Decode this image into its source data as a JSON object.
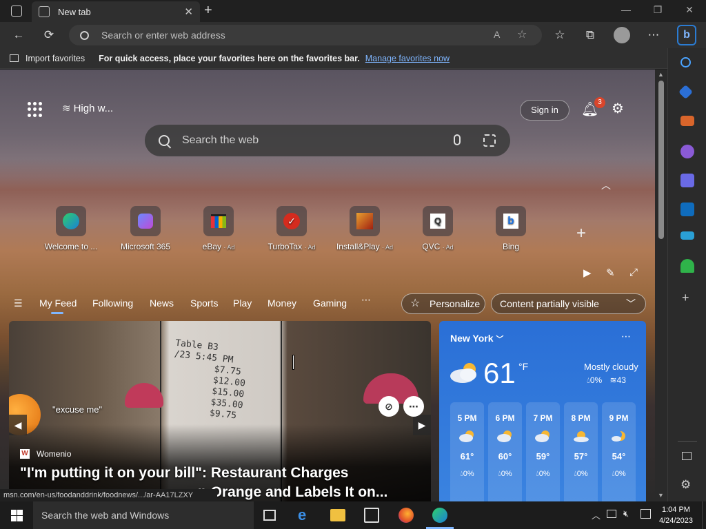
{
  "browser": {
    "tab_title": "New tab",
    "address_placeholder": "Search or enter web address",
    "favorites_bar": {
      "import_label": "Import favorites",
      "hint": "For quick access, place your favorites here on the favorites bar.",
      "manage_link": "Manage favorites now"
    }
  },
  "page": {
    "weather_mini": "High w...",
    "sign_in": "Sign in",
    "notification_count": "3",
    "search_placeholder": "Search the web",
    "quick_links": [
      {
        "label": "Welcome to ...",
        "ad": ""
      },
      {
        "label": "Microsoft 365",
        "ad": ""
      },
      {
        "label": "eBay",
        "ad": "· Ad"
      },
      {
        "label": "TurboTax",
        "ad": "· Ad"
      },
      {
        "label": "Install&Play",
        "ad": "· Ad"
      },
      {
        "label": "QVC",
        "ad": "· Ad"
      },
      {
        "label": "Bing",
        "ad": ""
      }
    ],
    "feed_tabs": [
      "My Feed",
      "Following",
      "News",
      "Sports",
      "Play",
      "Money",
      "Gaming"
    ],
    "personalize": "Personalize",
    "content_visibility": "Content partially visible",
    "news": {
      "source": "Womenio",
      "caption": "\"excuse me\"",
      "headline_line1": "\"I'm putting it on your bill\": Restaurant Charges",
      "headline_line2": "n Orange and Labels It on...",
      "receipt_lines": [
        "Table B3",
        "/23 5:45 PM",
        "$7.75",
        "$12.00",
        "$15.00",
        "$35.00",
        "$9.75"
      ]
    },
    "weather": {
      "city": "New York",
      "temp": "61",
      "unit": "°F",
      "condition": "Mostly cloudy",
      "precip": "0%",
      "wind": "43",
      "hourly": [
        {
          "time": "5 PM",
          "temp": "61°",
          "precip": "0%"
        },
        {
          "time": "6 PM",
          "temp": "60°",
          "precip": "0%"
        },
        {
          "time": "7 PM",
          "temp": "59°",
          "precip": "0%"
        },
        {
          "time": "8 PM",
          "temp": "57°",
          "precip": "0%"
        },
        {
          "time": "9 PM",
          "temp": "54°",
          "precip": "0%"
        }
      ]
    },
    "status_url": "msn.com/en-us/foodanddrink/foodnews/.../ar-AA17LZXY"
  },
  "taskbar": {
    "search_placeholder": "Search the web and Windows",
    "time": "1:04 PM",
    "date": "4/24/2023"
  },
  "colors": {
    "accent": "#7fb6ff",
    "weather_card": "#3a83e0",
    "badge": "#d9452b"
  }
}
